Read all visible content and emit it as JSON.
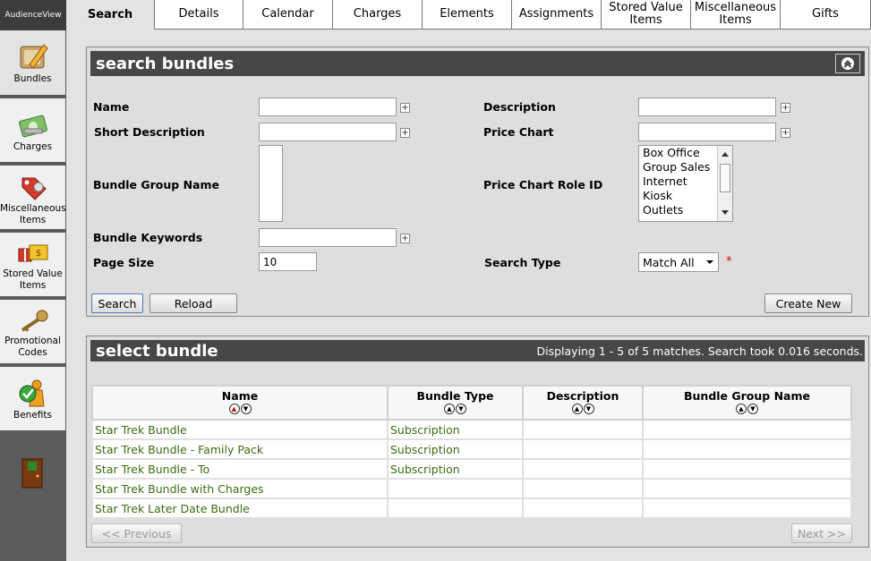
{
  "app": {
    "brand": "AudienceView"
  },
  "sidebar": {
    "items": [
      {
        "label": "Bundles",
        "icon": "pencil-tag-icon"
      },
      {
        "label": "Charges",
        "icon": "money-icon"
      },
      {
        "label": "Miscellaneous Items",
        "icon": "tag-icon"
      },
      {
        "label": "Stored Value Items",
        "icon": "gift-card-icon"
      },
      {
        "label": "Promotional Codes",
        "icon": "key-icon"
      },
      {
        "label": "Benefits",
        "icon": "person-check-icon"
      }
    ],
    "exit_icon": "exit-door-icon"
  },
  "tabs": [
    "Search",
    "Details",
    "Calendar",
    "Charges",
    "Elements",
    "Assignments",
    "Stored Value Items",
    "Miscellaneous Items",
    "Gifts"
  ],
  "search_panel": {
    "title": "search bundles",
    "fields": {
      "name": {
        "label": "Name",
        "value": ""
      },
      "short_description": {
        "label": "Short Description",
        "value": ""
      },
      "bundle_group_name": {
        "label": "Bundle Group Name"
      },
      "bundle_keywords": {
        "label": "Bundle Keywords",
        "value": ""
      },
      "page_size": {
        "label": "Page Size",
        "value": "10"
      },
      "description": {
        "label": "Description",
        "value": ""
      },
      "price_chart": {
        "label": "Price Chart",
        "value": ""
      },
      "price_chart_role_id": {
        "label": "Price Chart Role ID",
        "options": [
          "Box Office",
          "Group Sales",
          "Internet",
          "Kiosk",
          "Outlets"
        ]
      },
      "search_type": {
        "label": "Search Type",
        "value": "Match All",
        "required_mark": "*"
      }
    },
    "buttons": {
      "search": "Search",
      "reload": "Reload",
      "create_new": "Create New"
    }
  },
  "results_panel": {
    "title": "select bundle",
    "status": "Displaying 1 - 5 of 5 matches. Search took 0.016 seconds.",
    "columns": [
      "Name",
      "Bundle Type",
      "Description",
      "Bundle Group Name"
    ],
    "rows": [
      {
        "name": "Star Trek Bundle",
        "type": "Subscription",
        "description": "",
        "group": ""
      },
      {
        "name": "Star Trek Bundle - Family Pack",
        "type": "Subscription",
        "description": "",
        "group": ""
      },
      {
        "name": "Star Trek Bundle - To",
        "type": "Subscription",
        "description": "",
        "group": ""
      },
      {
        "name": "Star Trek Bundle with Charges",
        "type": "",
        "description": "",
        "group": ""
      },
      {
        "name": "Star Trek Later Date Bundle",
        "type": "",
        "description": "",
        "group": ""
      }
    ],
    "pager": {
      "previous": "<< Previous",
      "next": "Next >>"
    }
  },
  "colors": {
    "header_bar": "#474747",
    "link_green": "#3d6b14",
    "required_red": "#cc0000",
    "sidebar_bg": "#5b5b5b"
  }
}
